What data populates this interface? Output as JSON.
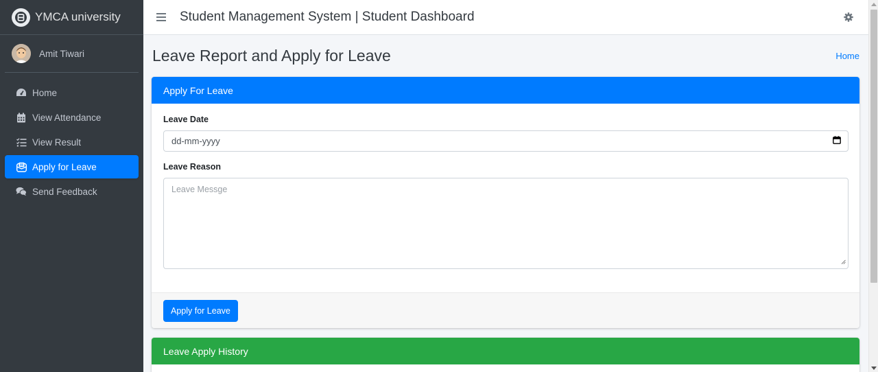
{
  "brand": {
    "name": "YMCA university"
  },
  "user": {
    "name": "Amit Tiwari"
  },
  "sidebar": {
    "items": [
      {
        "label": "Home",
        "icon": "dashboard-icon"
      },
      {
        "label": "View Attendance",
        "icon": "calendar-icon"
      },
      {
        "label": "View Result",
        "icon": "list-check-icon"
      },
      {
        "label": "Apply for Leave",
        "icon": "envelope-open-icon",
        "active": true
      },
      {
        "label": "Send Feedback",
        "icon": "comments-icon"
      }
    ]
  },
  "header": {
    "title": "Student Management System | Student Dashboard"
  },
  "page": {
    "title": "Leave Report and Apply for Leave",
    "breadcrumb": "Home"
  },
  "apply_card": {
    "header": "Apply For Leave",
    "date_label": "Leave Date",
    "date_placeholder": "dd-mm-yyyy",
    "reason_label": "Leave Reason",
    "reason_placeholder": "Leave Messge",
    "submit_label": "Apply for Leave"
  },
  "history_card": {
    "header": "Leave Apply History"
  },
  "colors": {
    "primary": "#007bff",
    "success": "#28a745",
    "sidebar": "#343a40"
  }
}
